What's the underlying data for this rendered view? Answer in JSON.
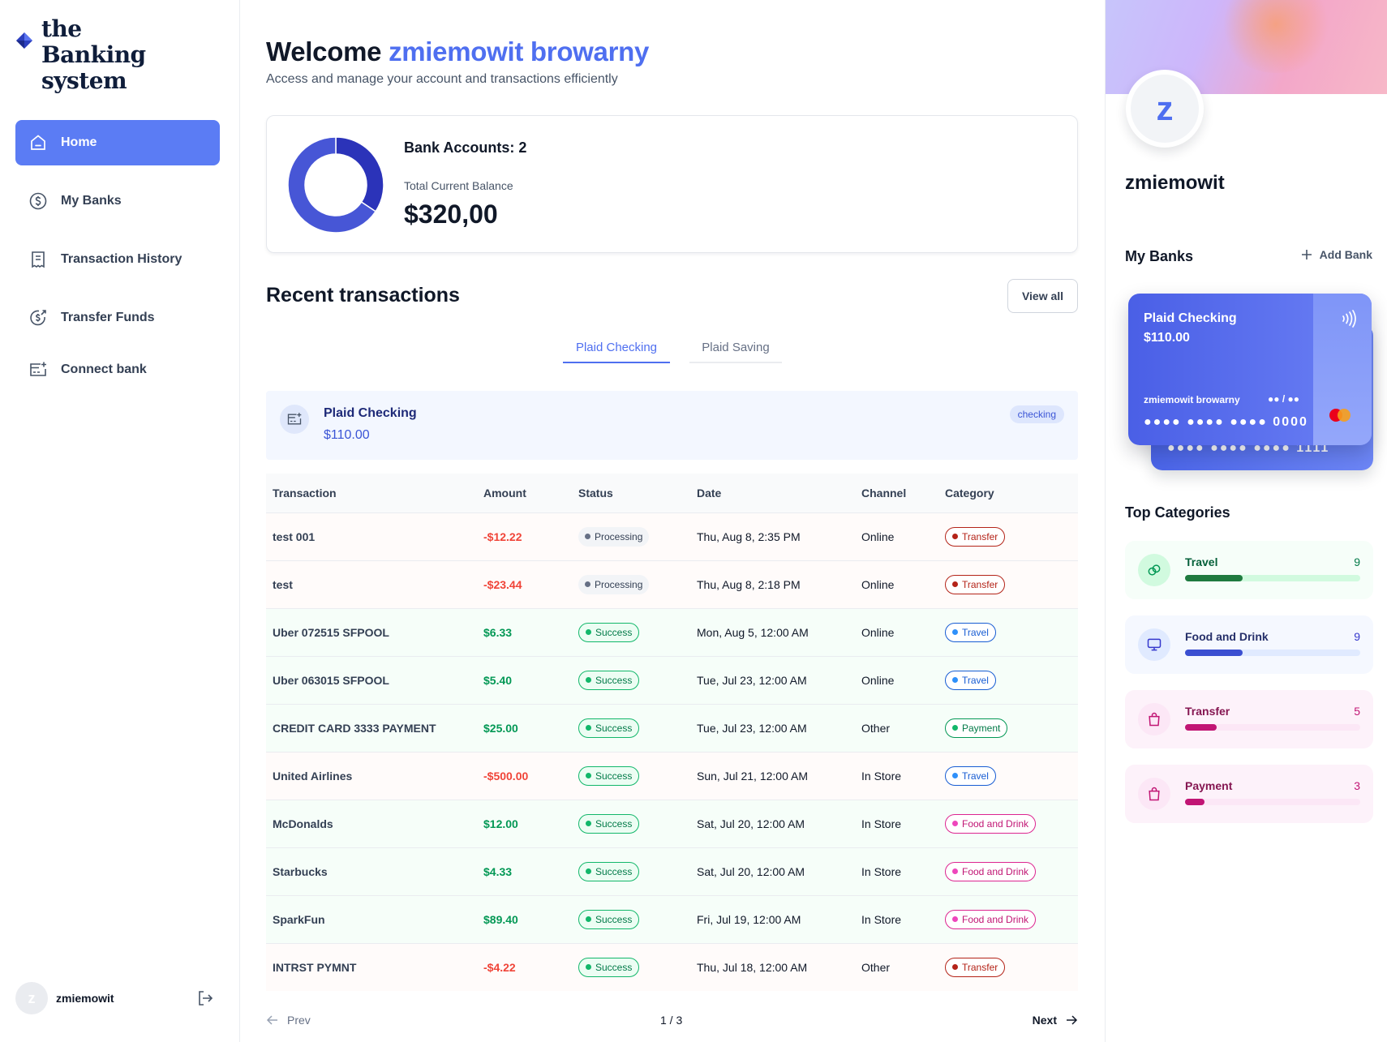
{
  "app": {
    "logo_text": "the Banking system"
  },
  "sidebar": {
    "items": [
      {
        "label": "Home",
        "icon": "home-icon",
        "active": true
      },
      {
        "label": "My Banks",
        "icon": "dollar-circle-icon"
      },
      {
        "label": "Transaction History",
        "icon": "receipt-icon"
      },
      {
        "label": "Transfer Funds",
        "icon": "money-send-icon"
      },
      {
        "label": "Connect bank",
        "icon": "card-add-icon"
      }
    ],
    "footer": {
      "avatar_initial": "z",
      "user_name": "zmiemowit"
    }
  },
  "header": {
    "welcome": "Welcome",
    "user_full_name": "zmiemowit browarny",
    "subtitle": "Access and manage your account and transactions efficiently"
  },
  "summary": {
    "accounts_label": "Bank Accounts: 2",
    "balance_label": "Total Current Balance",
    "balance": "$320,00",
    "donut": {
      "segments": [
        {
          "name": "Plaid Checking",
          "value": 110,
          "color": "#2b33b9"
        },
        {
          "name": "Plaid Saving",
          "value": 210,
          "color": "#4756d6"
        }
      ]
    }
  },
  "recent": {
    "title": "Recent transactions",
    "view_all": "View all",
    "tabs": [
      "Plaid Checking",
      "Plaid Saving"
    ],
    "account": {
      "name": "Plaid Checking",
      "balance": "$110.00",
      "type": "checking"
    },
    "columns": [
      "Transaction",
      "Amount",
      "Status",
      "Date",
      "Channel",
      "Category"
    ],
    "rows": [
      {
        "name": "test 001",
        "amount": "-$12.22",
        "kind": "neg",
        "status": "Processing",
        "date": "Thu, Aug 8, 2:35 PM",
        "channel": "Online",
        "category": "Transfer"
      },
      {
        "name": "test",
        "amount": "-$23.44",
        "kind": "neg",
        "status": "Processing",
        "date": "Thu, Aug 8, 2:18 PM",
        "channel": "Online",
        "category": "Transfer"
      },
      {
        "name": "Uber 072515 SFPOOL",
        "amount": "$6.33",
        "kind": "pos",
        "status": "Success",
        "date": "Mon, Aug 5, 12:00 AM",
        "channel": "Online",
        "category": "Travel"
      },
      {
        "name": "Uber 063015 SFPOOL",
        "amount": "$5.40",
        "kind": "pos",
        "status": "Success",
        "date": "Tue, Jul 23, 12:00 AM",
        "channel": "Online",
        "category": "Travel"
      },
      {
        "name": "CREDIT CARD 3333 PAYMENT",
        "amount": "$25.00",
        "kind": "pos",
        "status": "Success",
        "date": "Tue, Jul 23, 12:00 AM",
        "channel": "Other",
        "category": "Payment"
      },
      {
        "name": "United Airlines",
        "amount": "-$500.00",
        "kind": "neg",
        "status": "Success",
        "date": "Sun, Jul 21, 12:00 AM",
        "channel": "In Store",
        "category": "Travel"
      },
      {
        "name": "McDonalds",
        "amount": "$12.00",
        "kind": "pos",
        "status": "Success",
        "date": "Sat, Jul 20, 12:00 AM",
        "channel": "In Store",
        "category": "Food and Drink"
      },
      {
        "name": "Starbucks",
        "amount": "$4.33",
        "kind": "pos",
        "status": "Success",
        "date": "Sat, Jul 20, 12:00 AM",
        "channel": "In Store",
        "category": "Food and Drink"
      },
      {
        "name": "SparkFun",
        "amount": "$89.40",
        "kind": "pos",
        "status": "Success",
        "date": "Fri, Jul 19, 12:00 AM",
        "channel": "In Store",
        "category": "Food and Drink"
      },
      {
        "name": "INTRST PYMNT",
        "amount": "-$4.22",
        "kind": "neg",
        "status": "Success",
        "date": "Thu, Jul 18, 12:00 AM",
        "channel": "Other",
        "category": "Transfer"
      }
    ],
    "pagination": {
      "prev": "Prev",
      "page": "1 / 3",
      "next": "Next"
    }
  },
  "right": {
    "avatar_initial": "z",
    "name": "zmiemowit",
    "my_banks": "My Banks",
    "add_bank": "Add Bank",
    "card": {
      "name": "Plaid Checking",
      "balance": "$110.00",
      "holder": "zmiemowit browarny",
      "expiry": "●● / ●●",
      "number": "●●●● ●●●● ●●●● 0000"
    },
    "card_back": {
      "number": "●●●● ●●●● ●●●● 1111"
    },
    "top_categories_title": "Top Categories",
    "categories": [
      {
        "name": "Travel",
        "count": "9",
        "fraction": 0.33,
        "icon": "link-icon"
      },
      {
        "name": "Food and Drink",
        "count": "9",
        "fraction": 0.33,
        "icon": "monitor-icon"
      },
      {
        "name": "Transfer",
        "count": "5",
        "fraction": 0.18,
        "icon": "shopping-bag-icon"
      },
      {
        "name": "Payment",
        "count": "3",
        "fraction": 0.11,
        "icon": "shopping-bag-icon"
      }
    ]
  }
}
